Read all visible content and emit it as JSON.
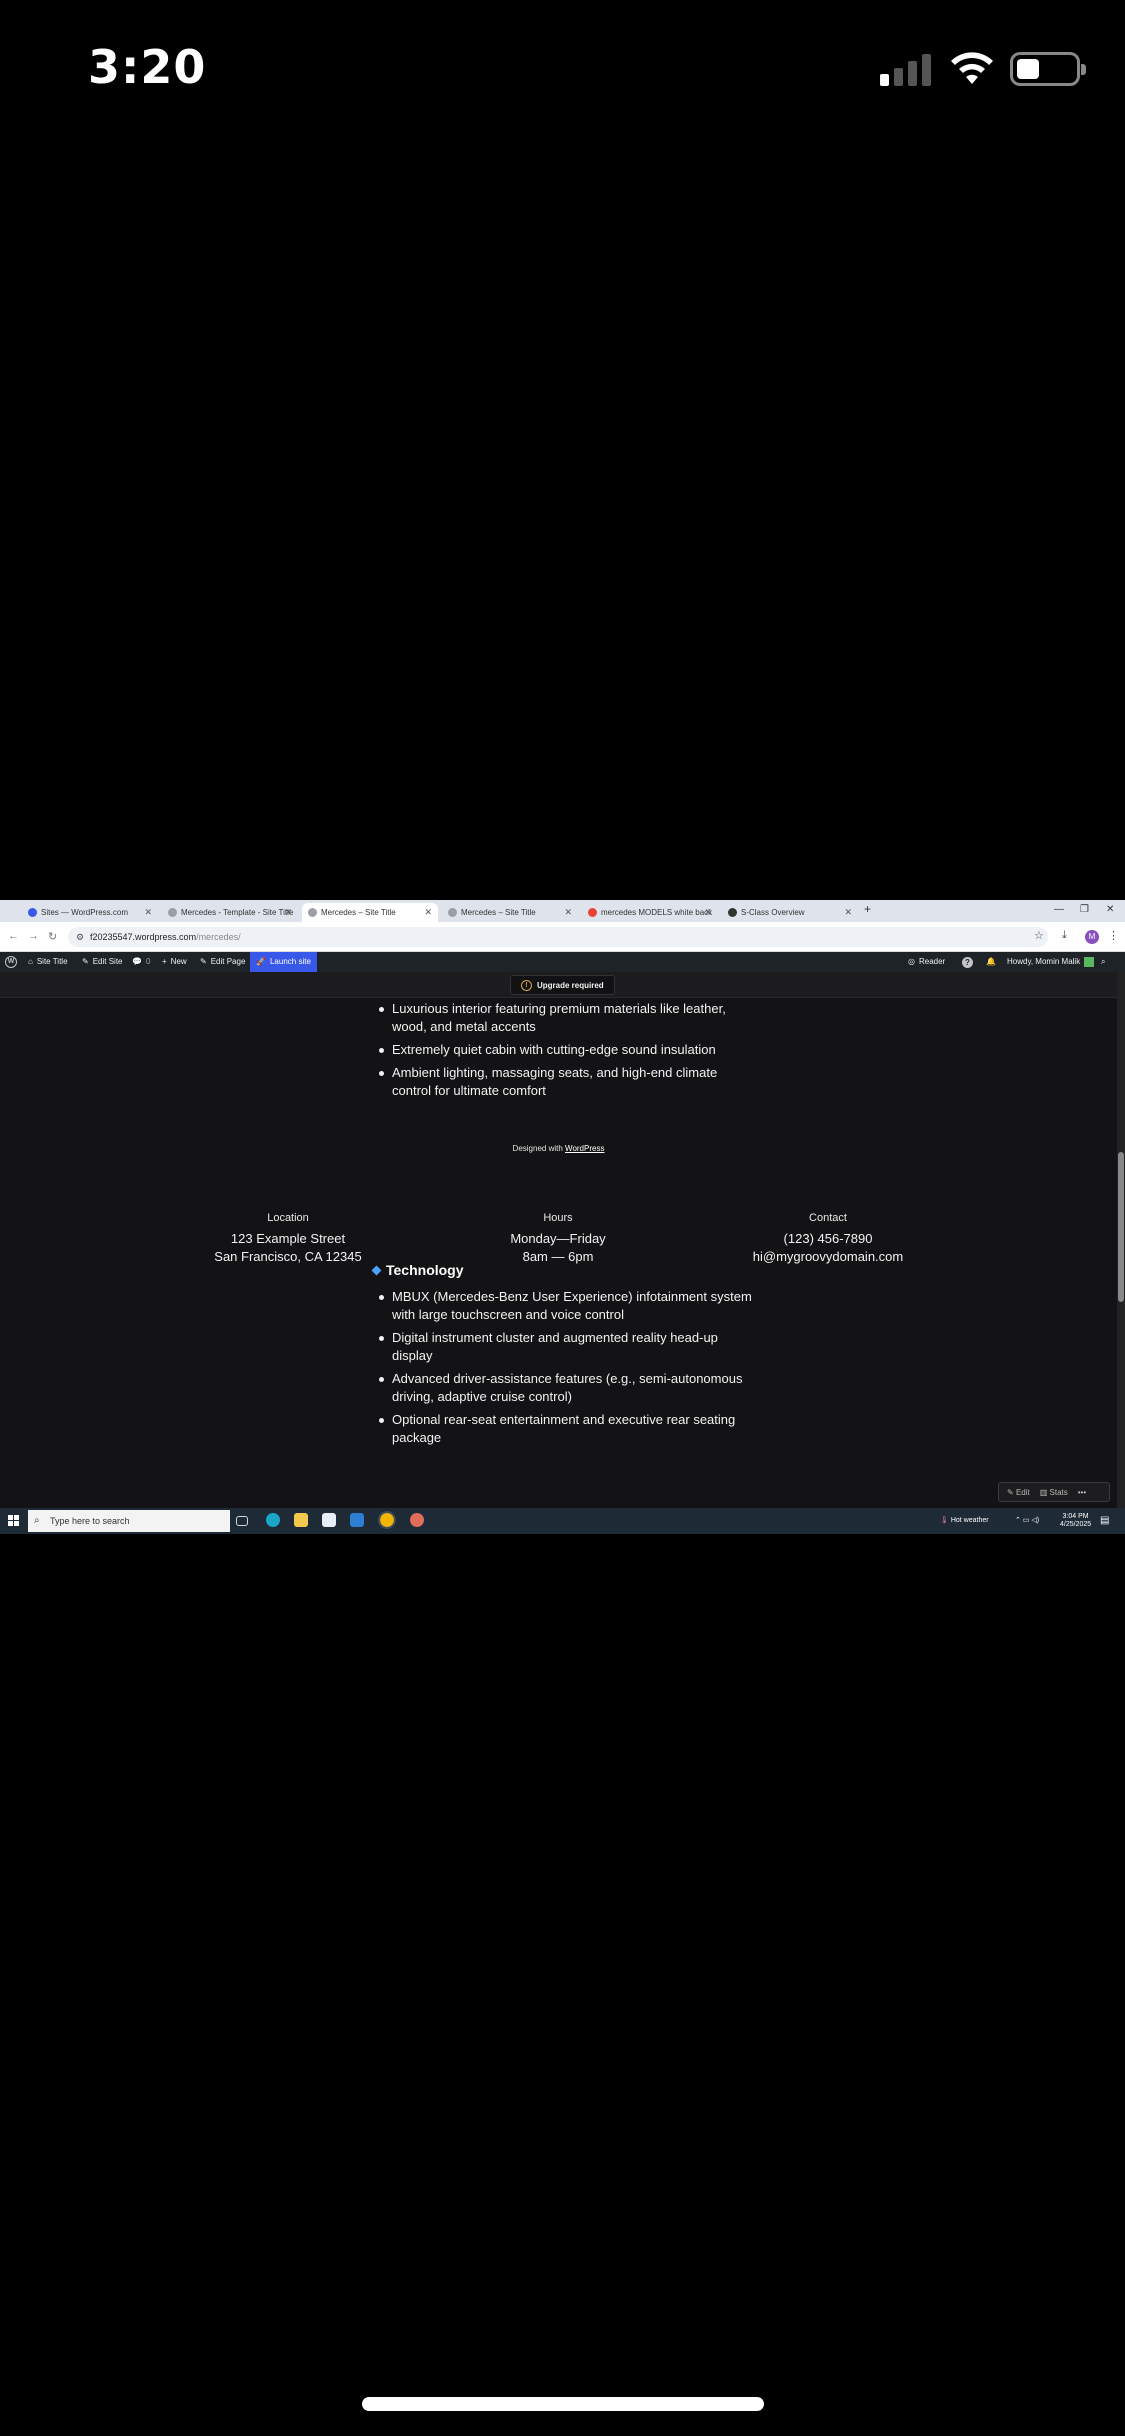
{
  "ios": {
    "time": "3:20"
  },
  "browser": {
    "tabs": [
      {
        "label": "Sites — WordPress.com",
        "favicon_color": "#3858e9"
      },
      {
        "label": "Mercedes - Template - Site Title",
        "favicon_color": "#9aa0a6"
      },
      {
        "label": "Mercedes – Site Title",
        "favicon_color": "#9aa0a6"
      },
      {
        "label": "Mercedes – Site Title",
        "favicon_color": "#9aa0a6"
      },
      {
        "label": "mercedes MODELS white back",
        "favicon_color": "#ea4335"
      },
      {
        "label": "S-Class Overview",
        "favicon_color": "#333333"
      }
    ],
    "new_tab": "+",
    "url_host": "f20235547.wordpress.com",
    "url_path": "/mercedes/",
    "profile_initial": "M"
  },
  "wp_admin": {
    "site_title": "Site Title",
    "edit_site": "Edit Site",
    "comments_count": "0",
    "new": "New",
    "edit_page": "Edit Page",
    "launch_site": "Launch site",
    "reader": "Reader",
    "help": "?",
    "howdy": "Howdy, Momin Malik"
  },
  "upgrade_notice": {
    "label": "Upgrade required"
  },
  "content": {
    "interior_list": [
      "Luxurious interior featuring premium materials like leather, wood, and metal accents",
      "Extremely quiet cabin with cutting-edge sound insulation",
      "Ambient lighting, massaging seats, and high-end climate control for ultimate comfort"
    ],
    "designed_with": "Designed with",
    "designed_with_link": "WordPress",
    "footer": {
      "location_heading": "Location",
      "location_line1": "123 Example Street",
      "location_line2": "San Francisco, CA 12345",
      "hours_heading": "Hours",
      "hours_line1": "Monday—Friday",
      "hours_line2": "8am — 6pm",
      "contact_heading": "Contact",
      "contact_line1": "(123) 456-7890",
      "contact_line2": "hi@mygroovydomain.com"
    },
    "technology_heading": "Technology",
    "technology_list": [
      "MBUX (Mercedes-Benz User Experience) infotainment system with large touchscreen and voice control",
      "Digital instrument cluster and augmented reality head-up display",
      "Advanced driver-assistance features (e.g., semi-autonomous driving, adaptive cruise control)",
      "Optional rear-seat entertainment and executive rear seating package"
    ]
  },
  "float_toolbar": {
    "edit": "Edit",
    "stats": "Stats",
    "more": "•••"
  },
  "taskbar": {
    "search_placeholder": "Type here to search",
    "weather": "Hot weather",
    "time": "3:04 PM",
    "date": "4/25/2025"
  }
}
